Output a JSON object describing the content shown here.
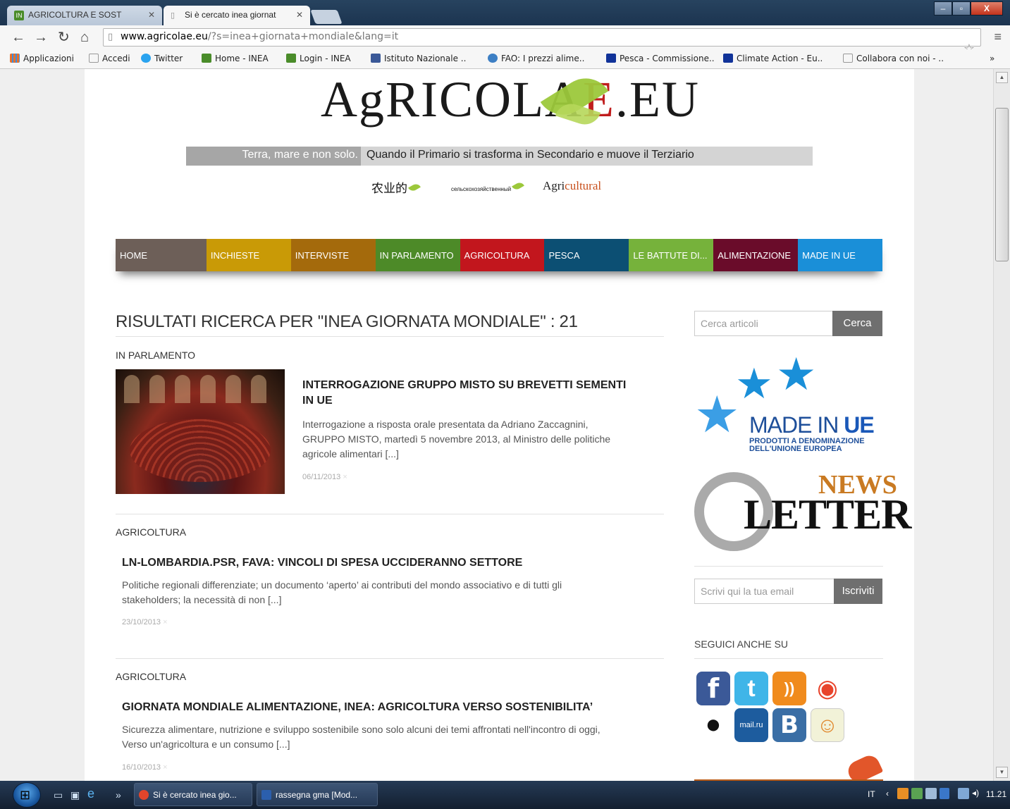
{
  "browser": {
    "tabs": [
      {
        "title": "AGRICOLTURA E SOST",
        "active": false
      },
      {
        "title": "Si è cercato inea giornat",
        "active": true
      }
    ],
    "url_host": "www.agricolae.eu",
    "url_path": "/?s=inea+giornata+mondiale&lang=it",
    "bookmarks": [
      {
        "label": "Applicazioni",
        "icon": "apps-grid-icon",
        "color": "#e7712c"
      },
      {
        "label": "Accedi",
        "icon": "page-icon",
        "color": "#cccccc"
      },
      {
        "label": "Twitter",
        "icon": "twitter-bird-icon",
        "color": "#2aa3ef"
      },
      {
        "label": "Home - INEA",
        "icon": "inea-icon",
        "color": "#4a8c2a"
      },
      {
        "label": "Login - INEA",
        "icon": "inea-icon",
        "color": "#4a8c2a"
      },
      {
        "label": "Istituto Nazionale ..",
        "icon": "facebook-icon",
        "color": "#3b5998"
      },
      {
        "label": "FAO: I prezzi alime..",
        "icon": "fao-icon",
        "color": "#3d7fc4"
      },
      {
        "label": "Pesca - Commissione..",
        "icon": "eu-flag-icon",
        "color": "#113399"
      },
      {
        "label": "Climate Action - Eu..",
        "icon": "eu-flag-icon",
        "color": "#113399"
      },
      {
        "label": "Collabora con noi - ..",
        "icon": "page-icon",
        "color": "#cccccc"
      }
    ],
    "bookmarks_more": "»"
  },
  "site": {
    "logo_text_a": "AgRICOLA",
    "logo_text_e": "E",
    "logo_text_b": ".EU",
    "tagline_left": "Terra, mare e non solo.",
    "tagline_right": "Quando il Primario si trasforma in Secondario e muove il Terziario",
    "lang_cn": "农业的",
    "lang_ru": "сельскохозяйственный",
    "lang_en_a": "Agri",
    "lang_en_b": "cultural",
    "nav": [
      {
        "label": "HOME",
        "color": "#6d5f58"
      },
      {
        "label": "INCHIESTE",
        "color": "#c99a06"
      },
      {
        "label": "INTERVISTE",
        "color": "#a46a0c"
      },
      {
        "label": "IN PARLAMENTO",
        "color": "#4d8a28"
      },
      {
        "label": "AGRICOLTURA",
        "color": "#c2161d"
      },
      {
        "label": "PESCA",
        "color": "#0c4f73"
      },
      {
        "label": "LE BATTUTE DI...",
        "color": "#76b23b"
      },
      {
        "label": "ALIMENTAZIONE",
        "color": "#6a0c2a"
      },
      {
        "label": "MADE IN UE",
        "color": "#1a8fd8"
      }
    ]
  },
  "results": {
    "heading": "RISULTATI RICERCA PER \"INEA GIORNATA MONDIALE\" : 21",
    "posts": [
      {
        "category": "IN PARLAMENTO",
        "title_line1": "INTERROGAZIONE GRUPPO MISTO SU BREVETTI SEMENTI",
        "title_line2": "IN UE",
        "excerpt_line1": "Interrogazione a risposta orale presentata da Adriano Zaccagnini,",
        "excerpt_line2": "GRUPPO MISTO, martedì 5 novembre 2013, al Ministro delle politiche",
        "excerpt_line3": "agricole alimentari [...]",
        "date": "06/11/2013",
        "marker": "×"
      },
      {
        "category": "AGRICOLTURA",
        "title_line1": "LN-LOMBARDIA.PSR, FAVA: VINCOLI DI SPESA UCCIDERANNO SETTORE",
        "excerpt_line1": "Politiche regionali differenziate; un documento ‘aperto’ ai contributi del mondo associativo e di tutti gli",
        "excerpt_line2": "stakeholders; la necessità di non [...]",
        "date": "23/10/2013",
        "marker": "×"
      },
      {
        "category": "AGRICOLTURA",
        "title_line1": "GIORNATA MONDIALE ALIMENTAZIONE, INEA: AGRICOLTURA VERSO SOSTENIBILITA’",
        "excerpt_line1": "Sicurezza alimentare, nutrizione e sviluppo sostenibile sono solo alcuni dei temi affrontati nell'incontro di oggi,",
        "excerpt_line2": "Verso un'agricoltura e un consumo [...]",
        "date": "16/10/2013",
        "marker": "×"
      }
    ]
  },
  "sidebar": {
    "search_placeholder": "Cerca articoli",
    "search_button": "Cerca",
    "madeinue_a": "MADE IN ",
    "madeinue_b": "UE",
    "madeinue_sub1": "PRODOTTI A DENOMINAZIONE",
    "madeinue_sub2": "DELL'UNIONE EUROPEA",
    "news_label": "NEWS",
    "letter_label": "LETTER",
    "at_label": "@",
    "email_placeholder": "Scrivi qui la tua email",
    "email_button": "Iscriviti",
    "follow_title": "SEGUICI ANCHE SU",
    "social": [
      {
        "name": "facebook",
        "glyph": "f",
        "color": "#3b5998"
      },
      {
        "name": "twitter",
        "glyph": "t",
        "color": "#3fb5e8"
      },
      {
        "name": "rss",
        "glyph": "))",
        "color": "#f08b1d"
      },
      {
        "name": "weibo",
        "glyph": "◉",
        "color": "#e8442c"
      },
      {
        "name": "qq",
        "glyph": "●",
        "color": "#111111"
      },
      {
        "name": "mailru",
        "glyph": "mail.ru",
        "color": "#1d5c9e"
      },
      {
        "name": "vkontakte",
        "glyph": "B",
        "color": "#3a6ea5"
      },
      {
        "name": "odnoklassniki",
        "glyph": "☺",
        "color": "#f2f2d8"
      }
    ]
  },
  "taskbar": {
    "tasks": [
      {
        "label": "Si è cercato inea gio...",
        "color": "#e2452c"
      },
      {
        "label": "rassegna gma [Mod...",
        "color": "#2b5fad"
      }
    ],
    "more": "»",
    "language": "IT",
    "clock": "11.21"
  }
}
